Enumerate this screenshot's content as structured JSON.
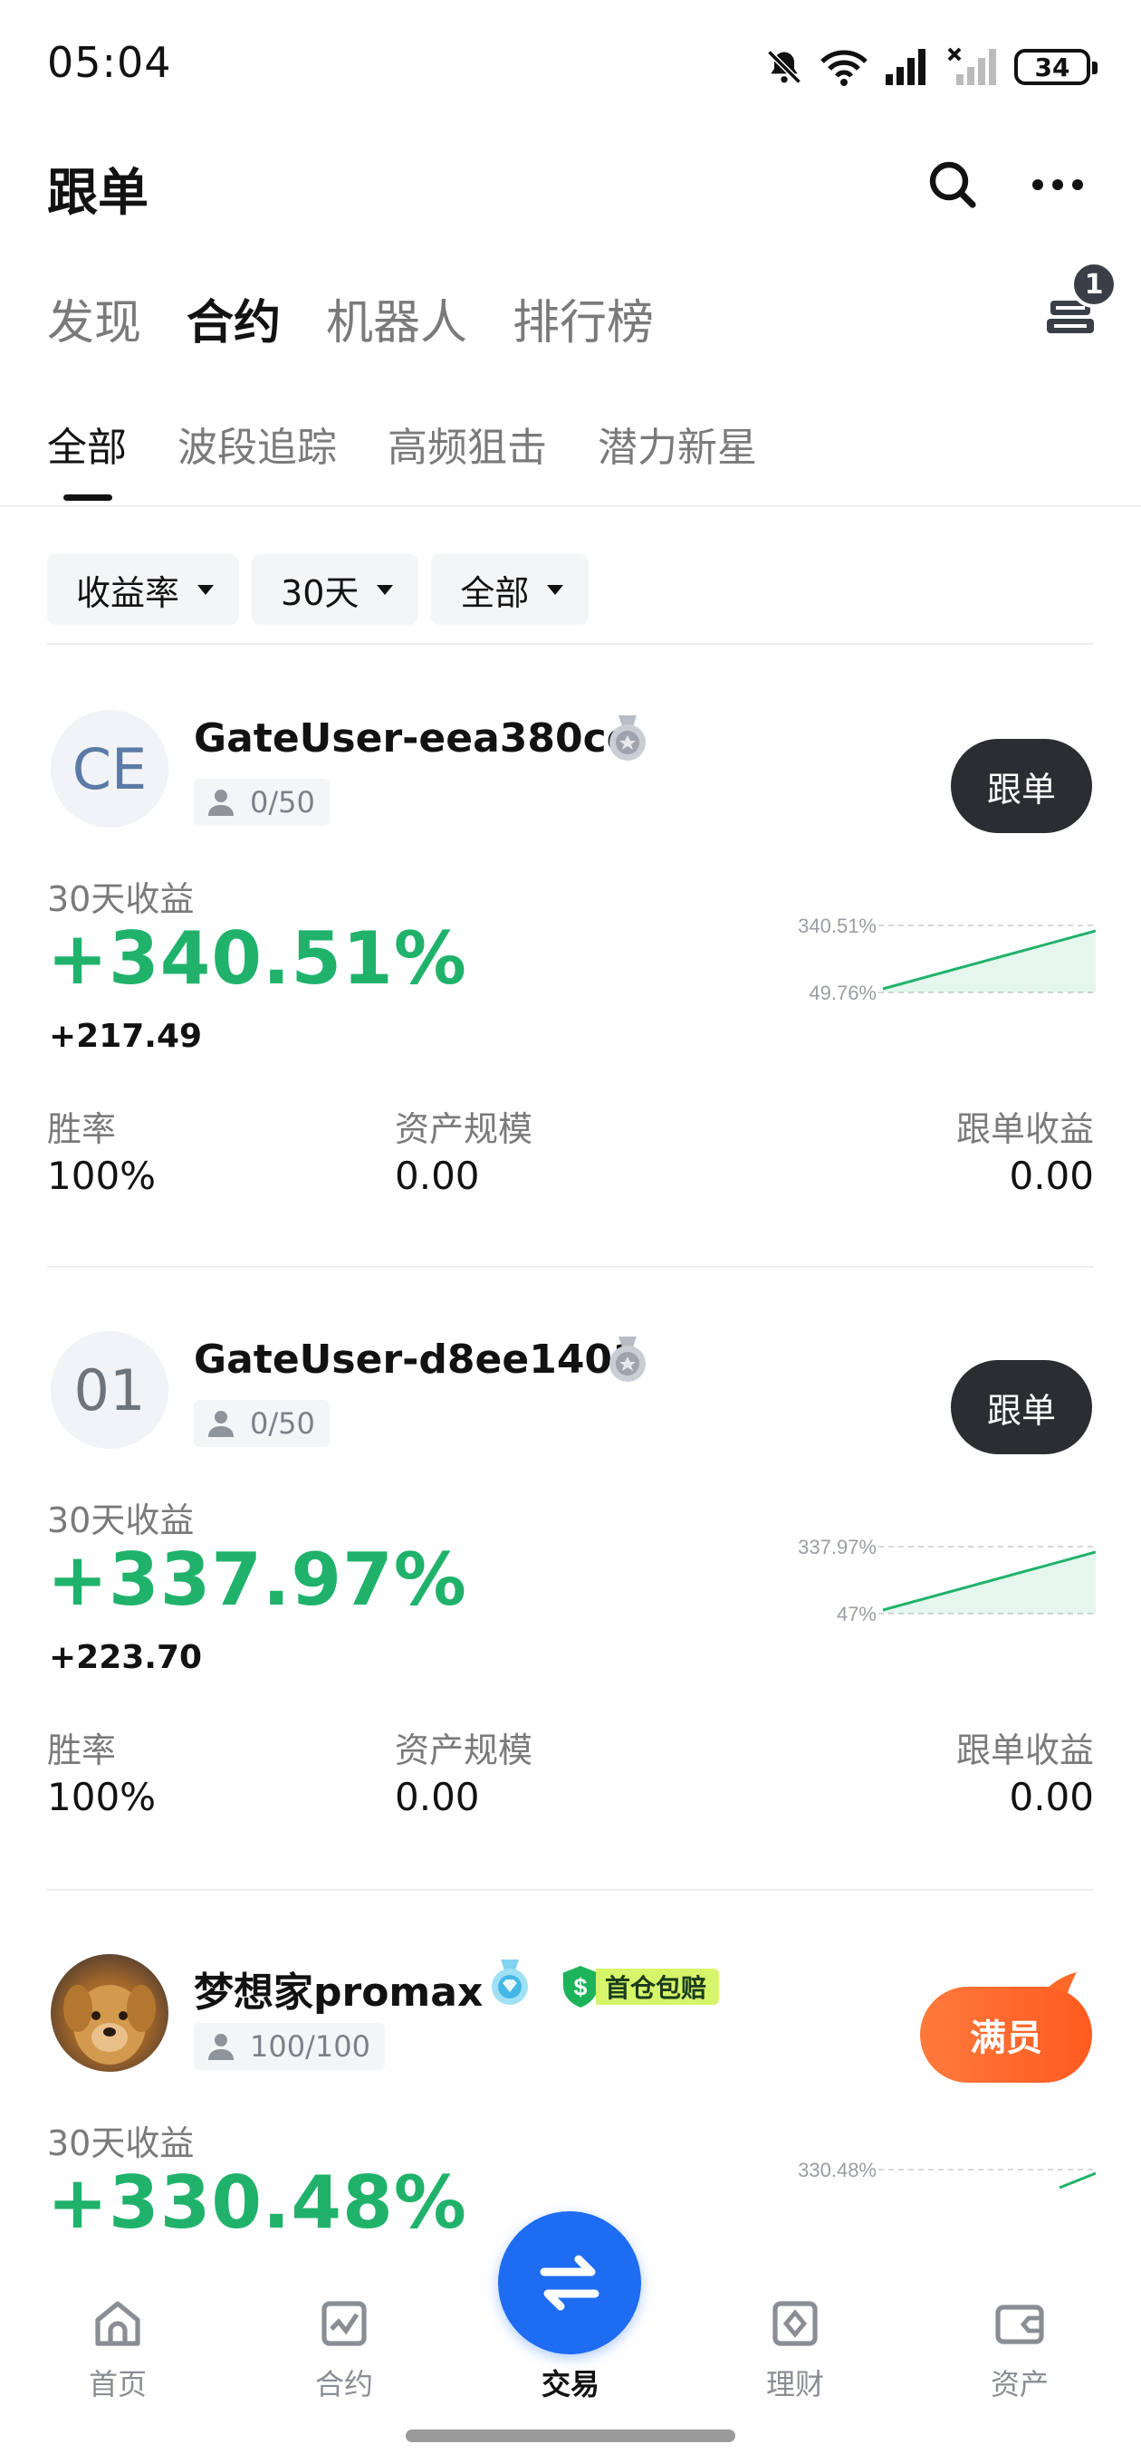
{
  "status_bar": {
    "time": "05:04",
    "battery": "34"
  },
  "header": {
    "title": "跟单"
  },
  "top_tabs": [
    {
      "label": "发现",
      "active": false
    },
    {
      "label": "合约",
      "active": true
    },
    {
      "label": "机器人",
      "active": false
    },
    {
      "label": "排行榜",
      "active": false
    }
  ],
  "cart_badge": "1",
  "sub_tabs": [
    {
      "label": "全部",
      "active": true
    },
    {
      "label": "波段追踪",
      "active": false
    },
    {
      "label": "高频狙击",
      "active": false
    },
    {
      "label": "潜力新星",
      "active": false
    }
  ],
  "filters": [
    {
      "label": "收益率"
    },
    {
      "label": "30天"
    },
    {
      "label": "全部"
    }
  ],
  "stat_labels": {
    "win_rate": "胜率",
    "aum": "资产规模",
    "copy_profit": "跟单收益",
    "period_return": "30天收益"
  },
  "traders": [
    {
      "avatar_text": "CE",
      "name": "GateUser-eea380ce",
      "followers": "0/50",
      "button": "跟单",
      "return_pct": "+340.51%",
      "return_abs": "+217.49",
      "chart_high": "340.51%",
      "chart_low": "49.76%",
      "win_rate": "100%",
      "aum": "0.00",
      "copy_profit": "0.00"
    },
    {
      "avatar_text": "01",
      "name": "GateUser-d8ee1401",
      "followers": "0/50",
      "button": "跟单",
      "return_pct": "+337.97%",
      "return_abs": "+223.70",
      "chart_high": "337.97%",
      "chart_low": "47%",
      "win_rate": "100%",
      "aum": "0.00",
      "copy_profit": "0.00"
    },
    {
      "avatar_text": "",
      "name": "梦想家promax",
      "tag": "首仓包赔",
      "followers": "100/100",
      "button": "满员",
      "return_pct": "+330.48%",
      "chart_high": "330.48%"
    }
  ],
  "bottom_nav": [
    {
      "label": "首页",
      "icon": "home-icon"
    },
    {
      "label": "合约",
      "icon": "chart-icon"
    },
    {
      "label": "交易",
      "icon": "swap-icon",
      "active": true
    },
    {
      "label": "理财",
      "icon": "wealth-icon"
    },
    {
      "label": "资产",
      "icon": "wallet-icon"
    }
  ],
  "colors": {
    "green": "#20b26b",
    "primary": "#1e6cf2",
    "dark_button": "#2b2d31",
    "full_button": "#ff5a1f"
  }
}
